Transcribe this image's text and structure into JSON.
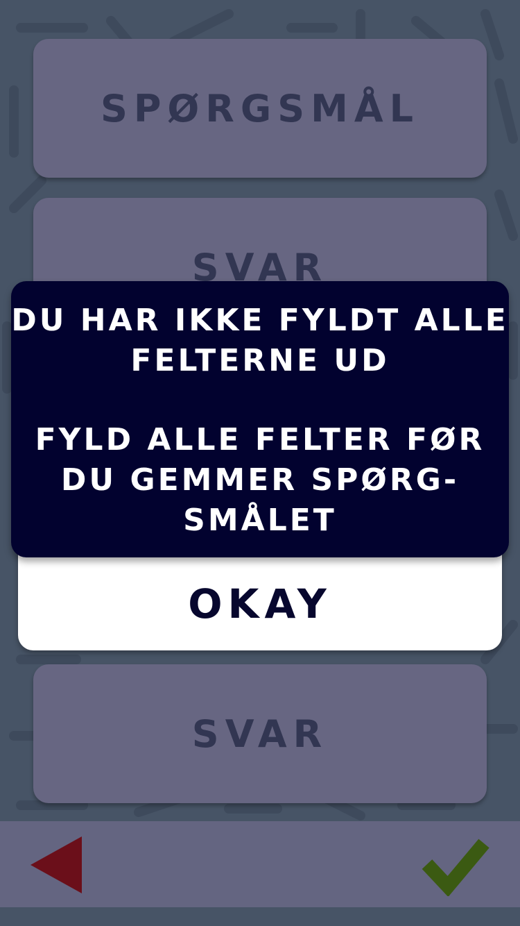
{
  "fields": {
    "question_label": "SPØRGSMÅL",
    "answer_label_1": "SVAR",
    "answer_label_4": "SVAR"
  },
  "dialog": {
    "message_line_1": "DU HAR IKKE FYLDT ALLE",
    "message_line_2": "FELTERNE UD",
    "message_line_3": "FYLD ALLE FELTER FØR",
    "message_line_4": "DU GEMMER SPØRG-",
    "message_line_5": "SMÅLET",
    "button_label": "OKAY"
  },
  "toolbar": {
    "back_icon": "back-arrow-icon",
    "confirm_icon": "checkmark-icon"
  },
  "colors": {
    "background": "#475466",
    "field": "#676682",
    "field_text": "#323652",
    "dialog": "#02022f",
    "dialog_text": "#ffffff",
    "back_icon": "#6b0f1a",
    "confirm_icon": "#3b5a12"
  }
}
